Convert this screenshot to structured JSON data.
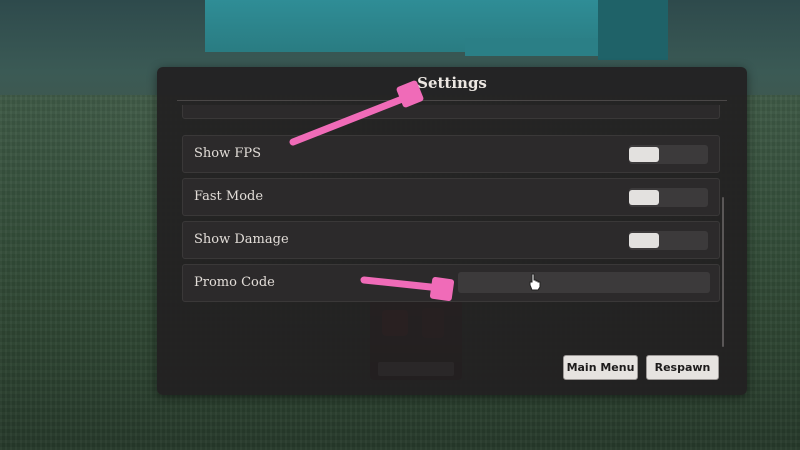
{
  "settings": {
    "title": "Settings",
    "rows": [
      {
        "label": "Show FPS",
        "type": "toggle"
      },
      {
        "label": "Fast Mode",
        "type": "toggle"
      },
      {
        "label": "Show Damage",
        "type": "toggle"
      },
      {
        "label": "Promo Code",
        "type": "input",
        "value": "",
        "placeholder": ""
      }
    ]
  },
  "buttons": {
    "main_menu": "Main Menu",
    "respawn": "Respawn"
  },
  "colors": {
    "annotation_arrow": "#f06bb8",
    "panel_bg": "#222021",
    "button_bg": "#e6e3e0"
  },
  "icons": {
    "pointer": "hand-pointer-icon",
    "arrow_to_title": "pink-arrow-icon",
    "arrow_to_promo": "pink-arrow-icon"
  }
}
